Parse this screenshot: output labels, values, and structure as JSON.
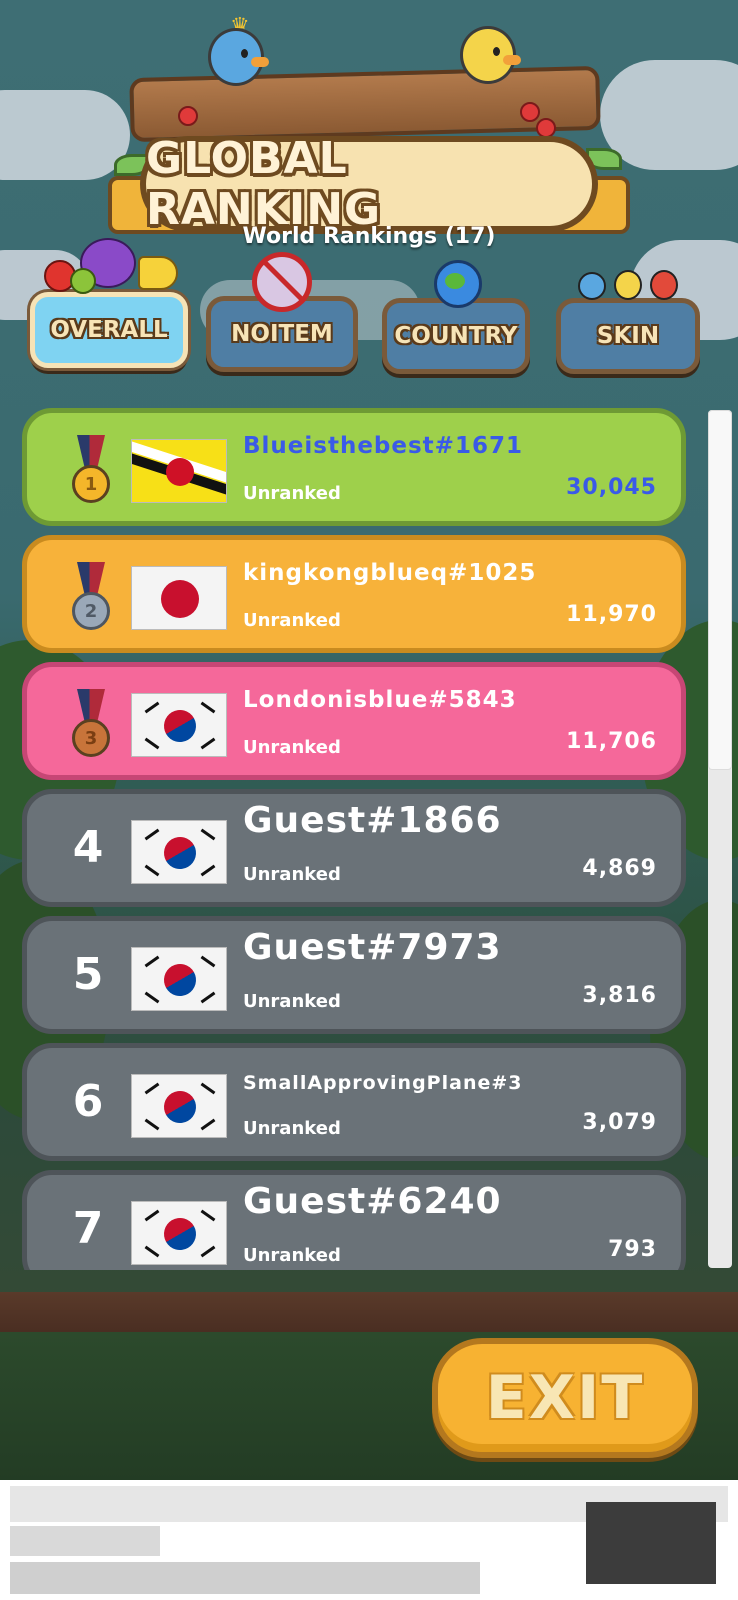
{
  "header": {
    "title": "GLOBAL RANKING",
    "subtitle": "World Rankings (17)"
  },
  "tabs": [
    {
      "label": "OVERALL",
      "active": true,
      "icon": "fruit-basket-icon"
    },
    {
      "label": "NOITEM",
      "active": false,
      "icon": "no-potion-icon"
    },
    {
      "label": "COUNTRY",
      "active": false,
      "icon": "globe-icon"
    },
    {
      "label": "SKIN",
      "active": false,
      "icon": "birds-icon"
    }
  ],
  "rankings": [
    {
      "rank": "1",
      "medal": "gold",
      "flag": "brunei",
      "name": "Blueisthebest#1671",
      "status": "Unranked",
      "score": "30,045"
    },
    {
      "rank": "2",
      "medal": "silver",
      "flag": "japan",
      "name": "kingkongblueq#1025",
      "status": "Unranked",
      "score": "11,970"
    },
    {
      "rank": "3",
      "medal": "bronze",
      "flag": "south-korea",
      "name": "Londonisblue#5843",
      "status": "Unranked",
      "score": "11,706"
    },
    {
      "rank": "4",
      "medal": "",
      "flag": "south-korea",
      "name": "Guest#1866",
      "status": "Unranked",
      "score": "4,869"
    },
    {
      "rank": "5",
      "medal": "",
      "flag": "south-korea",
      "name": "Guest#7973",
      "status": "Unranked",
      "score": "3,816"
    },
    {
      "rank": "6",
      "medal": "",
      "flag": "south-korea",
      "name": "SmallApprovingPlane#3",
      "status": "Unranked",
      "score": "3,079"
    },
    {
      "rank": "7",
      "medal": "",
      "flag": "south-korea",
      "name": "Guest#6240",
      "status": "Unranked",
      "score": "793"
    }
  ],
  "exit_button": {
    "label": "EXIT"
  },
  "colors": {
    "gold_row": "#9ed04b",
    "silver_row": "#f7b23a",
    "bronze_row": "#f5689a",
    "plain_row": "#6a7278",
    "active_tab": "#7fd3f2",
    "exit": "#f7b232"
  }
}
